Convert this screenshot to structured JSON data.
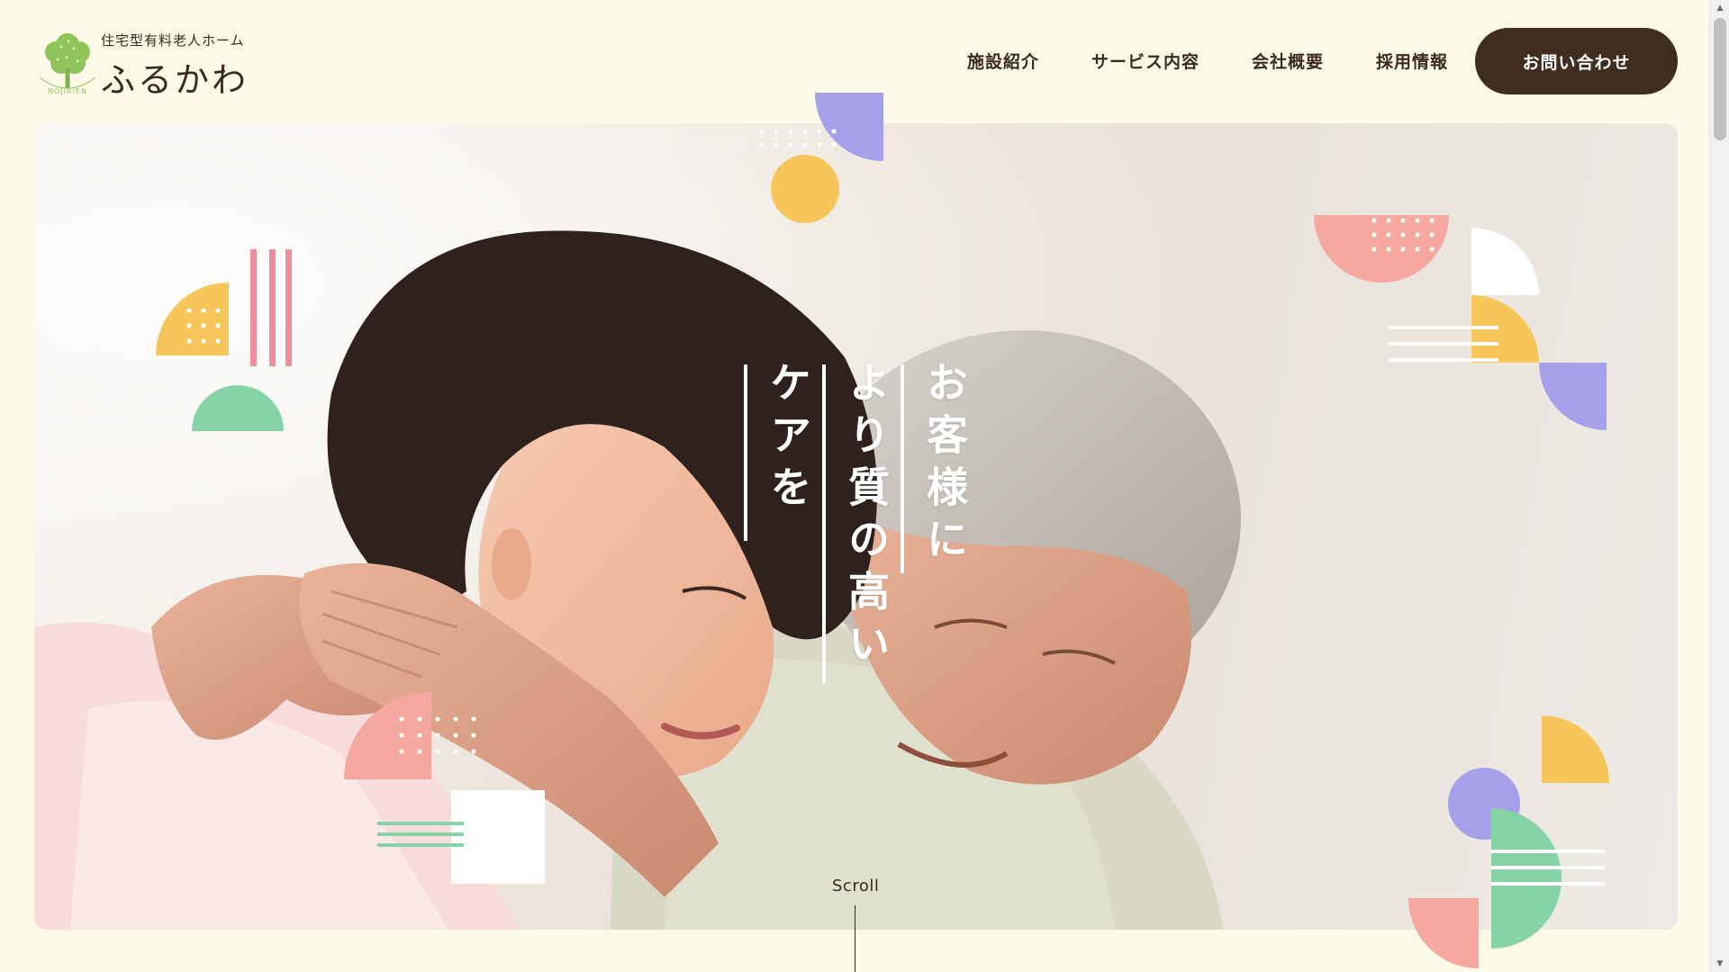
{
  "header": {
    "logo": {
      "subtitle": "住宅型有料老人ホーム",
      "name": "ふるかわ",
      "emblem_text": "NOJIRIEN",
      "icon": "tree-icon"
    },
    "nav": [
      {
        "label": "施設紹介"
      },
      {
        "label": "サービス内容"
      },
      {
        "label": "会社概要"
      },
      {
        "label": "採用情報"
      }
    ],
    "contact_label": "お問い合わせ"
  },
  "hero": {
    "headline_columns": [
      "お客様に",
      "より質の高い",
      "ケアを"
    ],
    "scroll_label": "Scroll",
    "photo_description_icon": "caregiver-photo"
  },
  "colors": {
    "background": "#fdf9e9",
    "text": "#3b2a1f",
    "button": "#412c20",
    "yellow": "#f7c65a",
    "purple": "#a6a0ea",
    "pink": "#f4a8a0",
    "green": "#86d3a8",
    "rose": "#ef8f9a"
  }
}
